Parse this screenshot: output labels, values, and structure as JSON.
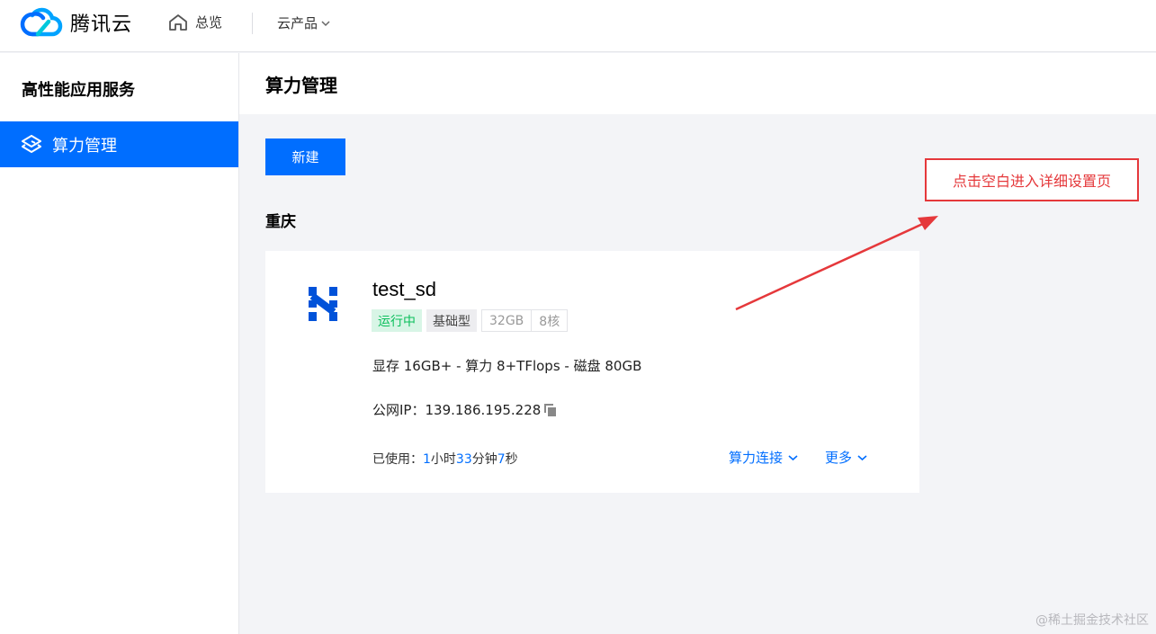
{
  "topbar": {
    "brand_name": "腾讯云",
    "home_label": "总览",
    "products_label": "云产品"
  },
  "sidebar": {
    "title": "高性能应用服务",
    "items": [
      {
        "label": "算力管理",
        "active": true
      }
    ]
  },
  "page": {
    "title": "算力管理",
    "new_button_label": "新建",
    "region": "重庆"
  },
  "instance": {
    "name": "test_sd",
    "status": "运行中",
    "type": "基础型",
    "memory": "32GB",
    "cores": "8核",
    "spec": "显存 16GB+ - 算力 8+TFlops - 磁盘 80GB",
    "ip_label": "公网IP：",
    "ip": "139.186.195.228",
    "uptime_label": "已使用：",
    "uptime_hours": "1",
    "uptime_hours_unit": "小时",
    "uptime_minutes": "33",
    "uptime_minutes_unit": "分钟",
    "uptime_seconds": "7",
    "uptime_seconds_unit": "秒",
    "actions": {
      "connect_label": "算力连接",
      "more_label": "更多"
    }
  },
  "annotation": {
    "text": "点击空白进入详细设置页"
  },
  "watermark": "@稀土掘金技术社区",
  "colors": {
    "primary": "#006eff",
    "status_green": "#0abf5b",
    "annotation_red": "#e5383b"
  }
}
